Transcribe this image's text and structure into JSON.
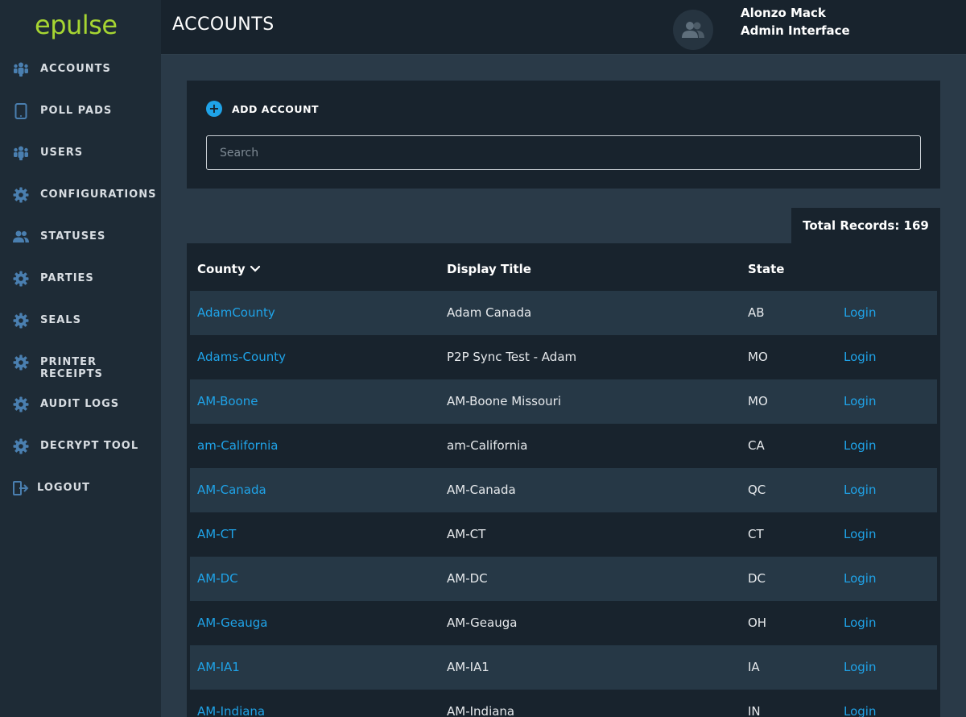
{
  "app": {
    "logo": "epulse"
  },
  "header": {
    "title": "ACCOUNTS",
    "user_name": "Alonzo Mack",
    "user_role": "Admin Interface"
  },
  "sidebar": {
    "items": [
      {
        "label": "ACCOUNTS",
        "icon": "users-icon"
      },
      {
        "label": "POLL PADS",
        "icon": "tablet-icon"
      },
      {
        "label": "USERS",
        "icon": "users-icon"
      },
      {
        "label": "CONFIGURATIONS",
        "icon": "gear-icon"
      },
      {
        "label": "STATUSES",
        "icon": "people-icon"
      },
      {
        "label": "PARTIES",
        "icon": "gear-icon"
      },
      {
        "label": "SEALS",
        "icon": "gear-icon"
      },
      {
        "label": "PRINTER RECEIPTS",
        "icon": "gear-icon"
      },
      {
        "label": "AUDIT LOGS",
        "icon": "gear-icon"
      },
      {
        "label": "DECRYPT TOOL",
        "icon": "gear-icon"
      },
      {
        "label": "LOGOUT",
        "icon": "logout-icon"
      }
    ]
  },
  "actions": {
    "add_label": "ADD ACCOUNT"
  },
  "search": {
    "placeholder": "Search",
    "value": ""
  },
  "table": {
    "total_label": "Total Records: 169",
    "columns": {
      "county": "County",
      "title": "Display Title",
      "state": "State"
    },
    "rows": [
      {
        "county": "AdamCounty",
        "title": "Adam Canada",
        "state": "AB",
        "action": "Login"
      },
      {
        "county": "Adams-County",
        "title": "P2P Sync Test - Adam",
        "state": "MO",
        "action": "Login"
      },
      {
        "county": "AM-Boone",
        "title": "AM-Boone Missouri",
        "state": "MO",
        "action": "Login"
      },
      {
        "county": "am-California",
        "title": "am-California",
        "state": "CA",
        "action": "Login"
      },
      {
        "county": "AM-Canada",
        "title": "AM-Canada",
        "state": "QC",
        "action": "Login"
      },
      {
        "county": "AM-CT",
        "title": "AM-CT",
        "state": "CT",
        "action": "Login"
      },
      {
        "county": "AM-DC",
        "title": "AM-DC",
        "state": "DC",
        "action": "Login"
      },
      {
        "county": "AM-Geauga",
        "title": "AM-Geauga",
        "state": "OH",
        "action": "Login"
      },
      {
        "county": "AM-IA1",
        "title": "AM-IA1",
        "state": "IA",
        "action": "Login"
      },
      {
        "county": "AM-Indiana",
        "title": "AM-Indiana",
        "state": "IN",
        "action": "Login"
      }
    ]
  },
  "colors": {
    "accent": "#1fa3e8",
    "brand": "#a6d532",
    "sidebar_bg": "#1e2b36",
    "panel_bg": "#18232d",
    "page_bg": "#2a3a48",
    "row_alt_bg": "#263846"
  }
}
